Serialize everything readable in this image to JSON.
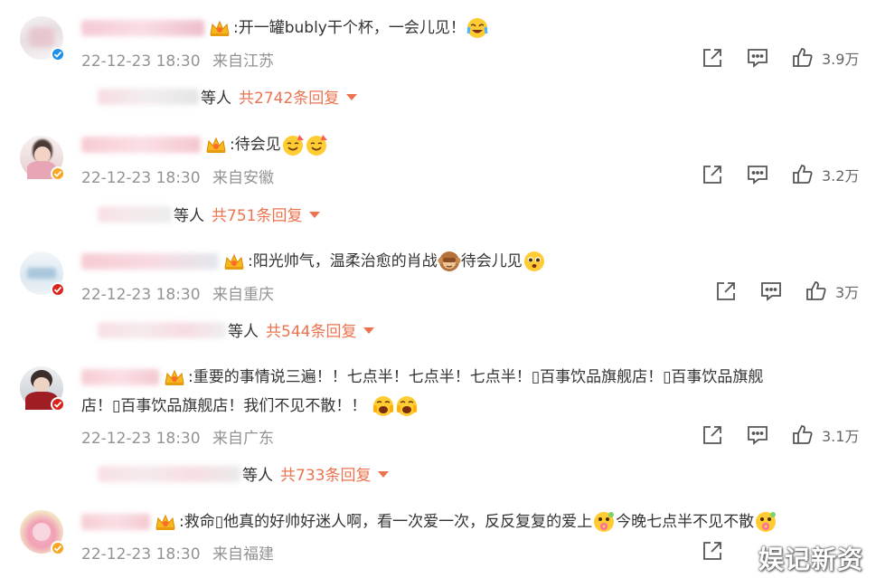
{
  "comments": [
    {
      "text_before": ":开一罐bubly干个杯，一会儿见！",
      "time": "22-12-23 18:30",
      "location": "来自江苏",
      "likes": "3.9万",
      "reply_suffix": "等人",
      "reply_total": "共2742条回复"
    },
    {
      "text_before": ":待会见",
      "time": "22-12-23 18:30",
      "location": "来自安徽",
      "likes": "3.2万",
      "reply_suffix": "等人",
      "reply_total": "共751条回复"
    },
    {
      "text_before": ":阳光帅气，温柔治愈的肖战",
      "text_after": "待会儿见",
      "time": "22-12-23 18:30",
      "location": "来自重庆",
      "likes": "3万",
      "reply_suffix": "等人",
      "reply_total": "共544条回复"
    },
    {
      "text_line1": ":重要的事情说三遍！！七点半！七点半！七点半！▯百事饮品旗舰店！▯百事饮品旗舰",
      "text_line2": "店！▯百事饮品旗舰店！我们不见不散！！",
      "time": "22-12-23 18:30",
      "location": "来自广东",
      "likes": "3.1万",
      "reply_suffix": "等人",
      "reply_total": "共733条回复"
    },
    {
      "text_before": ":救命▯他真的好帅好迷人啊，看一次爱一次，反反复复的爱上",
      "text_after": "今晚七点半不见不散",
      "time": "22-12-23 18:30",
      "location": "来自福建"
    }
  ],
  "watermark": "娱记新资",
  "colors": {
    "reply_link": "#eb7350",
    "meta_text": "#939393",
    "verified_blue": "#1d8fe8",
    "verified_orange": "#f6a623",
    "verified_red": "#d8241b"
  }
}
